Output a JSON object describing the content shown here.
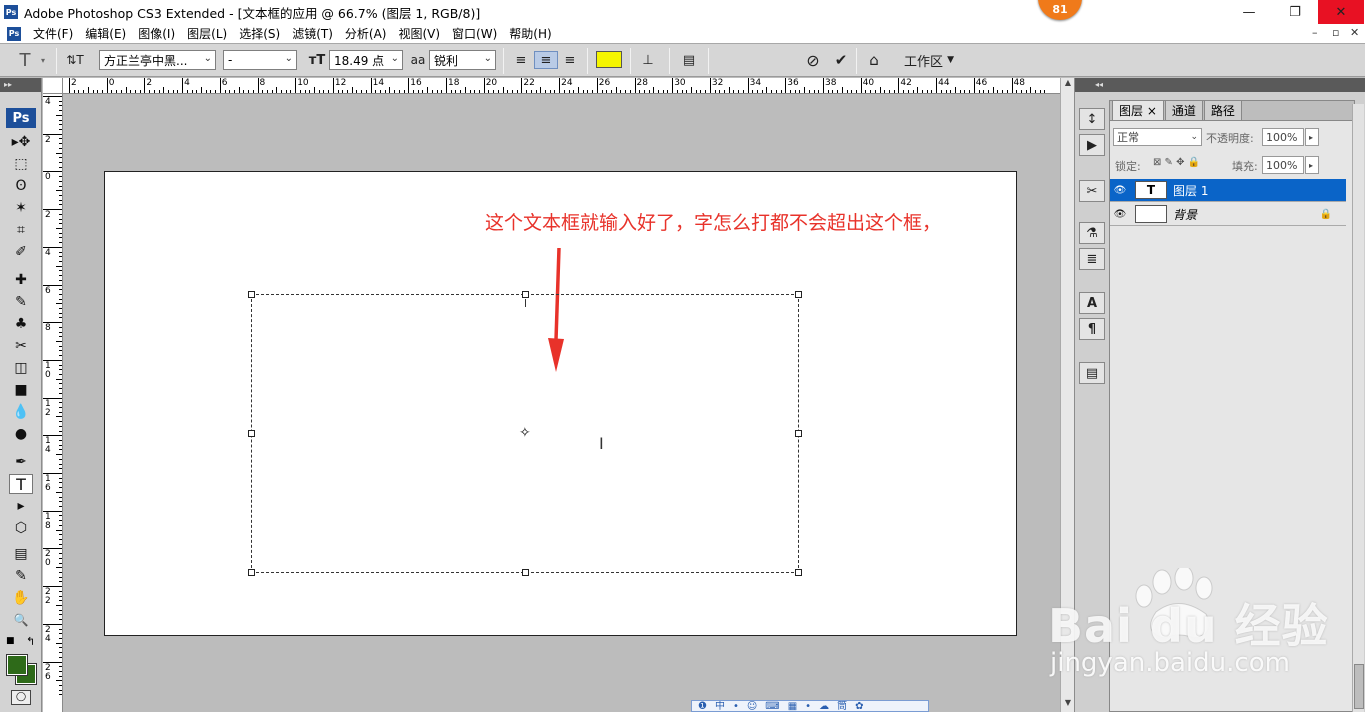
{
  "window": {
    "app_icon": "Ps",
    "title": "Adobe Photoshop CS3 Extended - [文本框的应用 @ 66.7% (图层 1, RGB/8)]",
    "badge": "81",
    "minimize": "—",
    "maximize": "❐",
    "close": "✕"
  },
  "menu": {
    "items": [
      "文件(F)",
      "编辑(E)",
      "图像(I)",
      "图层(L)",
      "选择(S)",
      "滤镜(T)",
      "分析(A)",
      "视图(V)",
      "窗口(W)",
      "帮助(H)"
    ],
    "doc_min": "–",
    "doc_restore": "▫",
    "doc_close": "✕"
  },
  "options": {
    "tool_glyph": "T",
    "orient_glyph": "⇅T",
    "font_family": "方正兰亭中黑...",
    "font_style": "-",
    "size_glyph": "тT",
    "font_size": "18.49 点",
    "aa_glyph": "aa",
    "anti_alias": "锐利",
    "align_left": "≡",
    "align_center": "≡",
    "align_right": "≡",
    "text_color": "#f5f500",
    "warp_glyph": "⊥",
    "panels_glyph": "▤",
    "cancel_glyph": "⊘",
    "commit_glyph": "✔",
    "bridge_glyph": "⌂",
    "workspace": "工作区"
  },
  "ruler": {
    "top_labels": [
      "2",
      "0",
      "2",
      "4",
      "6",
      "8",
      "10",
      "12",
      "14",
      "16",
      "18",
      "20",
      "22",
      "24",
      "26",
      "28",
      "30",
      "32",
      "34",
      "36",
      "38",
      "40",
      "42",
      "44",
      "46",
      "48"
    ],
    "left_labels": [
      "4",
      "2",
      "0",
      "2",
      "4",
      "6",
      "8",
      "10",
      "12",
      "14",
      "16",
      "18",
      "20",
      "22",
      "24",
      "26"
    ]
  },
  "canvas": {
    "annotation": "这个文本框就输入好了，字怎么打都不会超出这个框，",
    "center_glyph": "✧",
    "ibeam_glyph": "I"
  },
  "toolbox": {
    "ps_label": "Ps",
    "tools": [
      "▸✥",
      "⬚",
      "ʘ",
      "✶",
      "⌗",
      "✐",
      "✚",
      "✎",
      "♣",
      "✂",
      "◫",
      "■",
      "💧",
      "●",
      "✒",
      "T",
      "▸",
      "⬡",
      "▤",
      "✎",
      "✋",
      "🔍"
    ],
    "fg_color": "#2e6a19",
    "bg_color": "#2e6a19"
  },
  "ime": {
    "text": "❶中•☺⌨▦•☁筒✿"
  },
  "dock": {
    "icons": [
      "↕",
      "▶",
      "✂",
      "⚗",
      "≣",
      "A",
      "¶",
      "▤"
    ]
  },
  "layers": {
    "tabs": [
      "图层",
      "通道",
      "路径"
    ],
    "tab_close": "×",
    "blend_mode": "正常",
    "opacity_label": "不透明度:",
    "opacity": "100%",
    "lock_label": "锁定:",
    "lock_glyphs": "⊠ ✎ ✥ 🔒",
    "fill_label": "填充:",
    "fill": "100%",
    "rows": [
      {
        "name": "图层 1",
        "thumb": "T",
        "selected": true,
        "eye": "👁"
      },
      {
        "name": "背景",
        "thumb": "",
        "selected": false,
        "eye": "👁",
        "lock": "🔒"
      }
    ]
  },
  "watermark": {
    "brand": "Bai du 经验",
    "url": "jingyan.baidu.com"
  }
}
